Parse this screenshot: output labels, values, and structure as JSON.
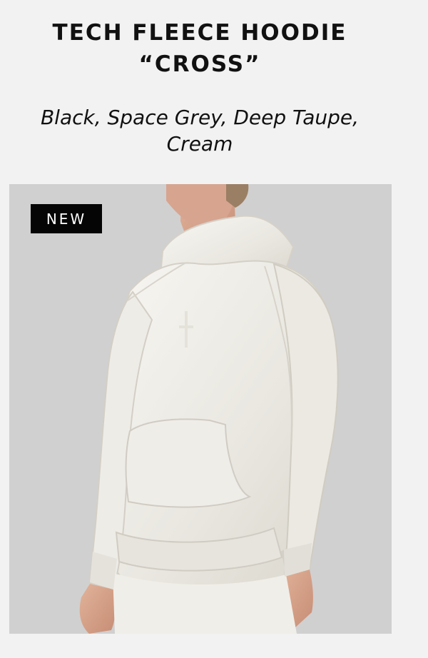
{
  "product": {
    "title_line_1": "TECH FLEECE HOODIE",
    "title_line_2": "“CROSS”",
    "colors_line_1": "Black, Space Grey, Deep Taupe,",
    "colors_line_2": "Cream",
    "badge": "NEW"
  },
  "image": {
    "background": "#d0d0d0",
    "hoodie_color": "#ebe9e3",
    "skin_color": "#d8aa92",
    "hair_color": "#9b7f64"
  }
}
